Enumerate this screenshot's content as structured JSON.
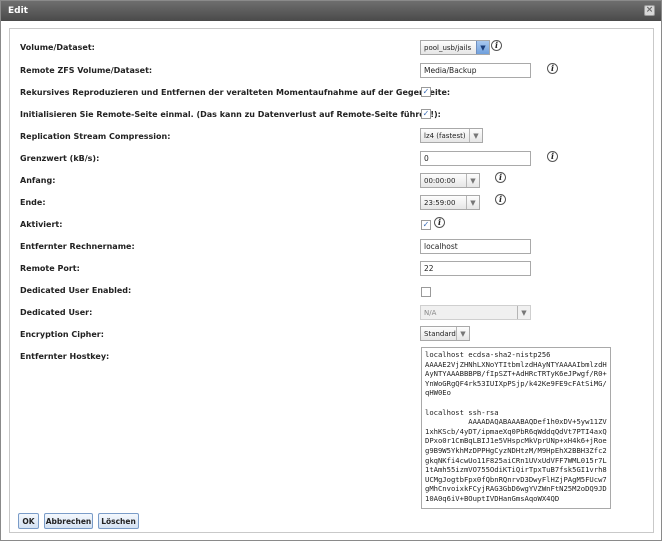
{
  "window": {
    "title": "Edit",
    "close_glyph": "×"
  },
  "form": {
    "volume_dataset": {
      "label": "Volume/Dataset:",
      "value": "pool_usb/jails"
    },
    "remote_volume": {
      "label": "Remote ZFS Volume/Dataset:",
      "value": "Media/Backup"
    },
    "recursive": {
      "label": "Rekursives Reproduzieren und Entfernen der veralteten Momentaufnahme auf der Gegenseite:",
      "checked": true
    },
    "initialize_remote": {
      "label": "Initialisieren Sie Remote-Seite einmal. (Das kann zu Datenverlust auf Remote-Seite führen!):",
      "checked": true
    },
    "compression": {
      "label": "Replication Stream Compression:",
      "value": "lz4 (fastest)"
    },
    "limit": {
      "label": "Grenzwert (kB/s):",
      "value": "0"
    },
    "begin": {
      "label": "Anfang:",
      "value": "00:00:00"
    },
    "end": {
      "label": "Ende:",
      "value": "23:59:00"
    },
    "enabled": {
      "label": "Aktiviert:",
      "checked": true
    },
    "remote_hostname": {
      "label": "Entfernter Rechnername:",
      "value": "localhost"
    },
    "remote_port": {
      "label": "Remote Port:",
      "value": "22"
    },
    "dedicated_user_enabled": {
      "label": "Dedicated User Enabled:",
      "checked": false
    },
    "dedicated_user": {
      "label": "Dedicated User:",
      "value": "N/A"
    },
    "cipher": {
      "label": "Encryption Cipher:",
      "value": "Standard"
    },
    "hostkey": {
      "label": "Entfernter Hostkey:",
      "value": "localhost ecdsa-sha2-nistp256\nAAAAE2VjZHNhLXNoYTItbmlzdHAyNTYAAAAIbmlzdHAyNTYAAABBBPB/fIpSZT+AdHRcTRTyK6eJPwgf/R0+YnWoGRgQF4rk53IUIXpPSjp/k42Ke9FE9cFAtSiMG/qHW0Eo\n\nlocalhost ssh-rsa\n          AAAADAQABAAABAQDef1h0xDV+5yw11ZV1xhKScb/4yDT/ipmaeXq0PbR6qWddqQdVt7PTI4axQDPxo0r1CmBqLBIJ1e5VHspcMkVprUNp+xH4k6+jRoeg9B9W5YkhMzDPPHgCyzNDHtzM/M9HpEhX2BBH3Zfc2gkqNKfi4cwUo11F825aiCRn1UVxUdVFF7WML015r7L1tAmh55izmVO755OdiKTiQirTpxTuB7fsk5GI1vrh8UCMgJogtbFpx0fQbnRQnrvD3DwyFlHZjPAgM5FUcw7gMhCnvoixkFCyjRAG3GbD6wgYVZWnFtN25M2oDQ9JD10A0q6iV+BOuptIVDHanGmsAqoWX4QD"
    }
  },
  "buttons": {
    "ok": "OK",
    "cancel": "Abbrechen",
    "delete": "Löschen"
  },
  "icons": {
    "info": "info-icon",
    "checkmark": "✓",
    "select_arrow": "▼"
  },
  "colors": {
    "title_bar": "#5a5a5a",
    "button_border": "#7a9cc8",
    "check": "#3a6db8"
  }
}
